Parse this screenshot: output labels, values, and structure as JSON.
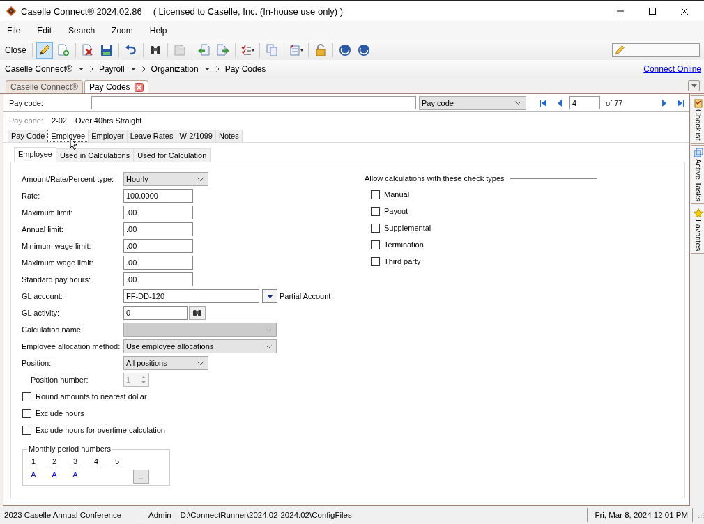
{
  "window": {
    "title": "Caselle Connect® 2024.02.86",
    "license": "( Licensed to Caselle, Inc. (In-house use only) )"
  },
  "menu": [
    "File",
    "Edit",
    "Search",
    "Zoom",
    "Help"
  ],
  "toolbar": {
    "close_label": "Close",
    "edit_mode": true
  },
  "breadcrumb": [
    {
      "label": "Caselle Connect®",
      "dropdown": true
    },
    {
      "label": "Payroll",
      "dropdown": true
    },
    {
      "label": "Organization",
      "dropdown": true
    },
    {
      "label": "Pay Codes",
      "dropdown": false
    }
  ],
  "connect_link": "Connect Online",
  "doc_tabs": [
    {
      "label": "Caselle Connect®",
      "selected": false,
      "closable": false
    },
    {
      "label": "Pay Codes",
      "selected": true,
      "closable": true
    }
  ],
  "lookup": {
    "label": "Pay code:",
    "search_by": "Pay code",
    "record": "4",
    "count": "of 77"
  },
  "current": {
    "label": "Pay code:",
    "code": "2-02",
    "description": "Over 40hrs Straight"
  },
  "tabs": [
    {
      "label": "Pay Code",
      "selected": false
    },
    {
      "label": "Employee",
      "selected": true
    },
    {
      "label": "Employer",
      "selected": false
    },
    {
      "label": "Leave Rates",
      "selected": false
    },
    {
      "label": "W-2/1099",
      "selected": false
    },
    {
      "label": "Notes",
      "selected": false
    }
  ],
  "sub_tabs": [
    {
      "label": "Employee",
      "selected": true
    },
    {
      "label": "Used in Calculations",
      "selected": false
    },
    {
      "label": "Used for Calculation",
      "selected": false
    }
  ],
  "fields": [
    {
      "label": "Amount/Rate/Percent type:",
      "kind": "dropdown",
      "value": "Hourly",
      "disabled": false
    },
    {
      "label": "Rate:",
      "kind": "text",
      "value": "100.0000",
      "disabled": false
    },
    {
      "label": "Maximum limit:",
      "kind": "text",
      "value": ".00",
      "disabled": false
    },
    {
      "label": "Annual limit:",
      "kind": "text",
      "value": ".00",
      "disabled": false
    },
    {
      "label": "Minimum wage limit:",
      "kind": "text",
      "value": ".00",
      "disabled": false
    },
    {
      "label": "Maximum wage limit:",
      "kind": "text",
      "value": ".00",
      "disabled": false
    },
    {
      "label": "Standard pay hours:",
      "kind": "text",
      "value": ".00",
      "disabled": false
    },
    {
      "label": "GL account:",
      "kind": "account",
      "value": "FF-DD-120",
      "note": "Partial Account",
      "disabled": false
    },
    {
      "label": "GL activity:",
      "kind": "lookup",
      "value": "0",
      "disabled": false
    },
    {
      "label": "Calculation name:",
      "kind": "wide-dropdown",
      "disabled": true
    },
    {
      "label": "Employee allocation method:",
      "kind": "wide-dropdown",
      "value": "Use employee allocations",
      "disabled": false
    },
    {
      "label": "Position:",
      "kind": "dropdown",
      "value": "All positions",
      "disabled": false
    },
    {
      "label": "Position number:",
      "kind": "spinner",
      "value": "1",
      "disabled": true
    }
  ],
  "options": [
    {
      "label": "Round amounts to nearest dollar",
      "checked": false
    },
    {
      "label": "Exclude hours",
      "checked": false
    },
    {
      "label": "Exclude hours for overtime calculation",
      "checked": false
    }
  ],
  "monthly_periods": {
    "title": "Monthly period numbers",
    "button": "..",
    "periods": [
      {
        "number": "1",
        "mark": "A"
      },
      {
        "number": "2",
        "mark": "A"
      },
      {
        "number": "3",
        "mark": "A"
      },
      {
        "number": "4"
      },
      {
        "number": "5"
      }
    ]
  },
  "check_types": {
    "title": "Allow calculations with these check types",
    "items": [
      {
        "label": "Manual",
        "checked": false
      },
      {
        "label": "Payout",
        "checked": false
      },
      {
        "label": "Supplemental",
        "checked": false
      },
      {
        "label": "Termination",
        "checked": false
      },
      {
        "label": "Third party",
        "checked": false
      }
    ]
  },
  "side_tabs": [
    "Checklist",
    "Active Tasks",
    "Favorites"
  ],
  "status_bar": [
    "2023 Caselle Annual Conference",
    "Admin",
    "D:\\ConnectRunner\\2024.02-2024.02\\ConfigFiles",
    "Fri, Mar 8, 2024 12 01 PM"
  ]
}
